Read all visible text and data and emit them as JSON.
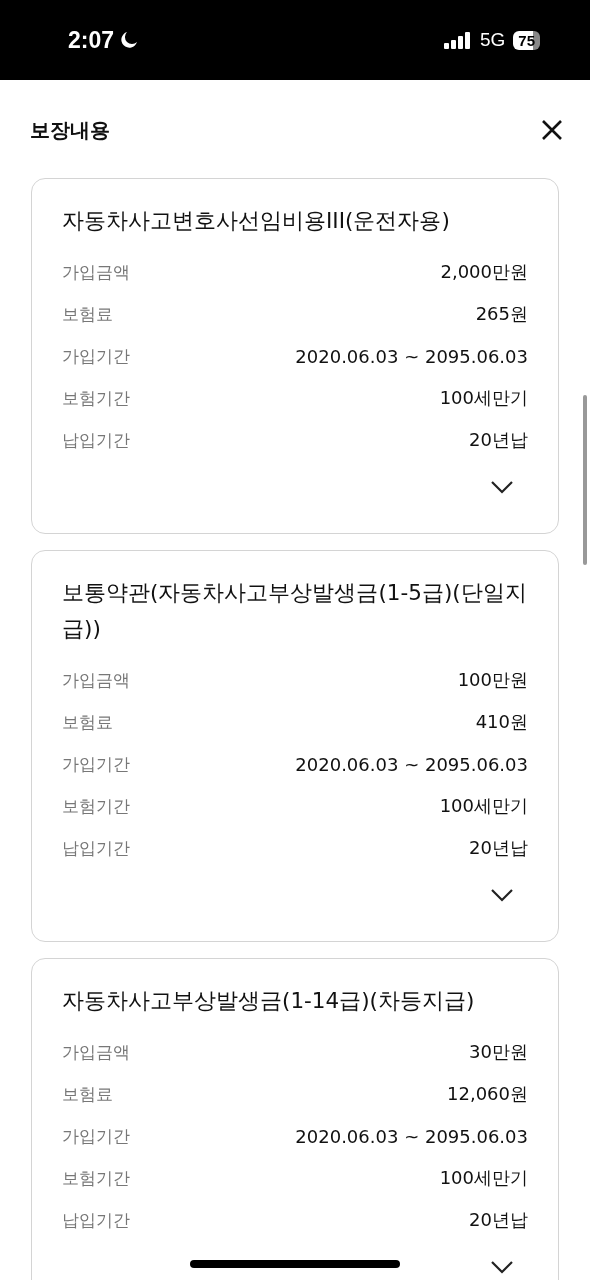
{
  "status_bar": {
    "time": "2:07",
    "network": "5G",
    "battery": "75"
  },
  "header": {
    "title": "보장내용"
  },
  "coverages": [
    {
      "title": "자동차사고변호사선임비용III(운전자용)",
      "rows": [
        {
          "label": "가입금액",
          "value": "2,000만원"
        },
        {
          "label": "보험료",
          "value": "265원"
        },
        {
          "label": "가입기간",
          "value": "2020.06.03 ~ 2095.06.03"
        },
        {
          "label": "보험기간",
          "value": "100세만기"
        },
        {
          "label": "납입기간",
          "value": "20년납"
        }
      ],
      "expanded": false
    },
    {
      "title": "보통약관(자동차사고부상발생금(1-5급)(단일지급))",
      "rows": [
        {
          "label": "가입금액",
          "value": "100만원"
        },
        {
          "label": "보험료",
          "value": "410원"
        },
        {
          "label": "가입기간",
          "value": "2020.06.03 ~ 2095.06.03"
        },
        {
          "label": "보험기간",
          "value": "100세만기"
        },
        {
          "label": "납입기간",
          "value": "20년납"
        }
      ],
      "expanded": false
    },
    {
      "title": "자동차사고부상발생금(1-14급)(차등지급)",
      "rows": [
        {
          "label": "가입금액",
          "value": "30만원"
        },
        {
          "label": "보험료",
          "value": "12,060원"
        },
        {
          "label": "가입기간",
          "value": "2020.06.03 ~ 2095.06.03"
        },
        {
          "label": "보험기간",
          "value": "100세만기"
        },
        {
          "label": "납입기간",
          "value": "20년납"
        }
      ],
      "expanded": false
    }
  ]
}
